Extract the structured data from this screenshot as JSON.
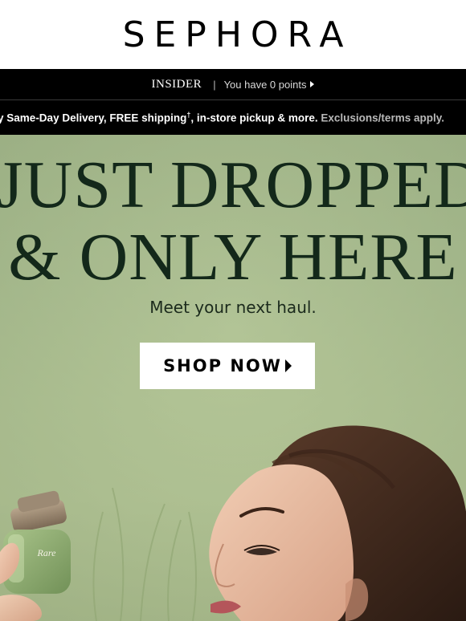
{
  "header": {
    "logo": "SEPHORA"
  },
  "insider_bar": {
    "program": "INSIDER",
    "separator": "|",
    "points_text": "You have 0 points"
  },
  "benefits_bar": {
    "text_start": "y Same-Day Delivery, FREE shipping",
    "dagger": "†",
    "text_end": ", in-store pickup & more. ",
    "terms": "Exclusions/terms apply."
  },
  "hero": {
    "headline_line1": "JUST DROPPED",
    "headline_line2": "& ONLY HERE",
    "subline": "Meet your next haul.",
    "cta_label": "SHOP NOW",
    "product_label": "Rare"
  },
  "colors": {
    "hero_bg": "#a4b88d",
    "headline": "#13281a",
    "bar_bg": "#000000"
  }
}
